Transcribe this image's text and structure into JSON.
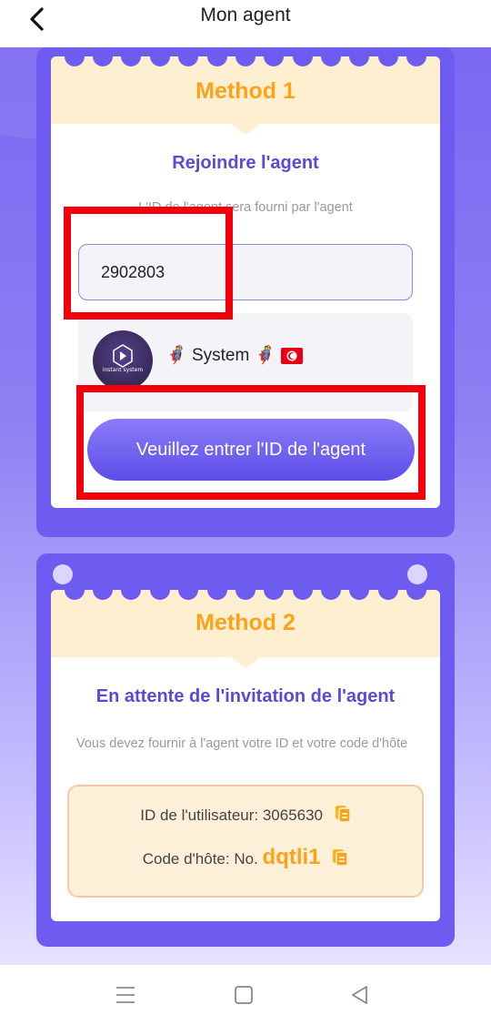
{
  "header": {
    "title": "Mon agent"
  },
  "method1": {
    "title": "Method 1",
    "section_title": "Rejoindre l'agent",
    "hint": "L'ID de l'agent sera fourni par l'agent",
    "agent_id_value": "2902803",
    "agent_name": "System",
    "avatar_text": "instant system",
    "button_label": "Veuillez entrer l'ID de l'agent"
  },
  "method2": {
    "title": "Method 2",
    "section_title": "En attente de l'invitation de l'agent",
    "hint": "Vous devez fournir à l'agent votre ID et votre code d'hôte",
    "user_id_label": "ID de l'utilisateur: 3065630",
    "host_code_label": "Code d'hôte: No.",
    "host_code_value": "dqtli1"
  },
  "colors": {
    "accent": "#6e5cf0",
    "method_title": "#ffa21a",
    "highlight": "#f2000b"
  },
  "icons": [
    "back-arrow-icon",
    "copy-icon",
    "menu-icon",
    "home-square-icon",
    "back-triangle-icon"
  ]
}
